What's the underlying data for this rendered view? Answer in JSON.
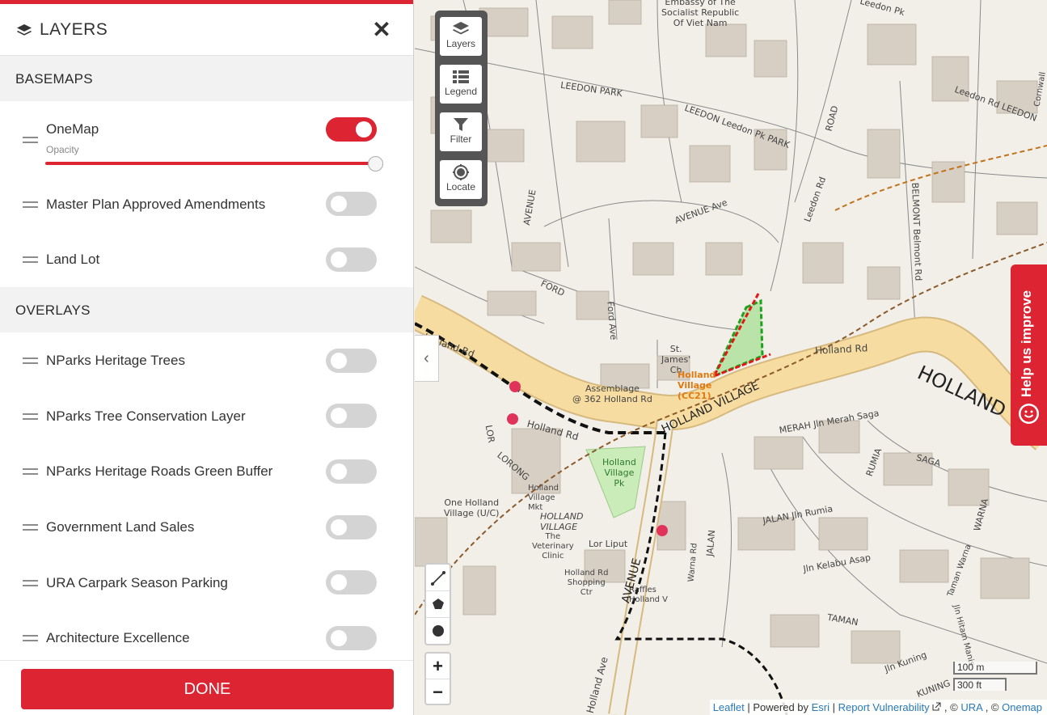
{
  "panel": {
    "title": "LAYERS",
    "title_icon": "layers-icon",
    "close_icon": "close-icon",
    "close_glyph": "✕",
    "sections": {
      "basemaps": "BASEMAPS",
      "overlays": "OVERLAYS"
    },
    "basemaps": [
      {
        "label": "OneMap",
        "enabled": true
      },
      {
        "label": "Master Plan Approved Amendments",
        "enabled": false
      },
      {
        "label": "Land Lot",
        "enabled": false
      }
    ],
    "opacity_label": "Opacity",
    "opacity_value": 1.0,
    "overlays": [
      {
        "label": "NParks Heritage Trees",
        "enabled": false
      },
      {
        "label": "NParks Tree Conservation Layer",
        "enabled": false
      },
      {
        "label": "NParks Heritage Roads Green Buffer",
        "enabled": false
      },
      {
        "label": "Government Land Sales",
        "enabled": false
      },
      {
        "label": "URA Carpark Season Parking",
        "enabled": false
      },
      {
        "label": "Architecture Excellence",
        "enabled": false
      }
    ],
    "done_label": "DONE"
  },
  "map": {
    "toolbar": [
      {
        "label": "Layers",
        "icon": "layers-icon"
      },
      {
        "label": "Legend",
        "icon": "legend-icon"
      },
      {
        "label": "Filter",
        "icon": "filter-icon"
      },
      {
        "label": "Locate",
        "icon": "locate-icon"
      }
    ],
    "collapse_glyph": "‹",
    "draw_tools": [
      "polyline-icon",
      "polygon-icon",
      "circle-icon"
    ],
    "zoom_in": "+",
    "zoom_out": "−",
    "scale": {
      "metric": "100 m",
      "imperial": "300 ft"
    },
    "help_label": "Help us improve",
    "attribution": {
      "leaflet": "Leaflet",
      "powered_by": "| Powered by",
      "esri": "Esri",
      "sep": "|",
      "report": "Report Vulnerability",
      "copy1": ", ©",
      "ura": "URA",
      "copy2": ", ©",
      "onemap": "Onemap"
    },
    "labels": {
      "embassy": "Embassy of The\nSocialist Republic\nOf Viet Nam",
      "leedon_pk_top": "Leedon Pk",
      "leedon_park": "LEEDON  PARK",
      "leedon_park2": "LEEDON  Leedon Pk  PARK",
      "leedon_rd": "Leedon Rd",
      "road": "ROAD",
      "belmont": "BELMONT  Belmont Rd",
      "leedon_rd_right": "Leedon Rd LEEDON",
      "avenue_top": "AVENUE",
      "avenue_mid": "AVENUE  Ave",
      "ford": "FORD",
      "ford_ave": "Ford Ave",
      "holland_rd_left": "Holland Rd",
      "holland_rd_mid": "Holland Rd",
      "holland_rd_right": "Holland Rd",
      "holland_big": "HOLLAND",
      "st_james": "St.\nJames'\nCh",
      "holland_village_mrt": "Holland\nVillage\n(CC21)",
      "assemblage": "Assemblage\n@ 362 Holland Rd",
      "holland_village_road": "HOLLAND VILLAGE",
      "holland_village_pk": "Holland\nVillage\nPk",
      "one_holland": "One Holland\nVillage (U/C)",
      "lorong": "LORONG",
      "lor": "LOR",
      "holland_village_mkt": "Holland\nVillage\nMkt",
      "holland_village_centre": "HOLLAND\nVILLAGE",
      "the_vet": "The\nVeterinary\nClinic",
      "lor_liput": "Lor Liput",
      "hv_shopping": "Holland Rd\nShopping\nCtr",
      "raffles": "Raffles\nHolland V",
      "avenue_bottom": "AVENUE",
      "holland_ave": "Holland Ave",
      "jalan_merah_saga": "MERAH  Jln Merah Saga",
      "saga": "SAGA",
      "rumia": "RUMIA",
      "jalan_rumia": "JALAN  Jln Rumia",
      "jln_kelabu": "Jln Kelabu Asap",
      "taman": "TAMAN",
      "jalan": "JALAN",
      "warna_rd": "Warna Rd",
      "jln_kuning": "Jln Kuning",
      "warna": "WARNA",
      "kuning": "KUNING",
      "taman_warna": "Taman Warna",
      "jalan_hitam": "Jln Hitam Manis",
      "cornwall": "Cornwall"
    },
    "colors": {
      "road_major": "#f6dca0",
      "land": "#f2eee8",
      "building": "#d8cfc4",
      "accent": "#dc2433",
      "park": "#c9ecb8"
    }
  }
}
